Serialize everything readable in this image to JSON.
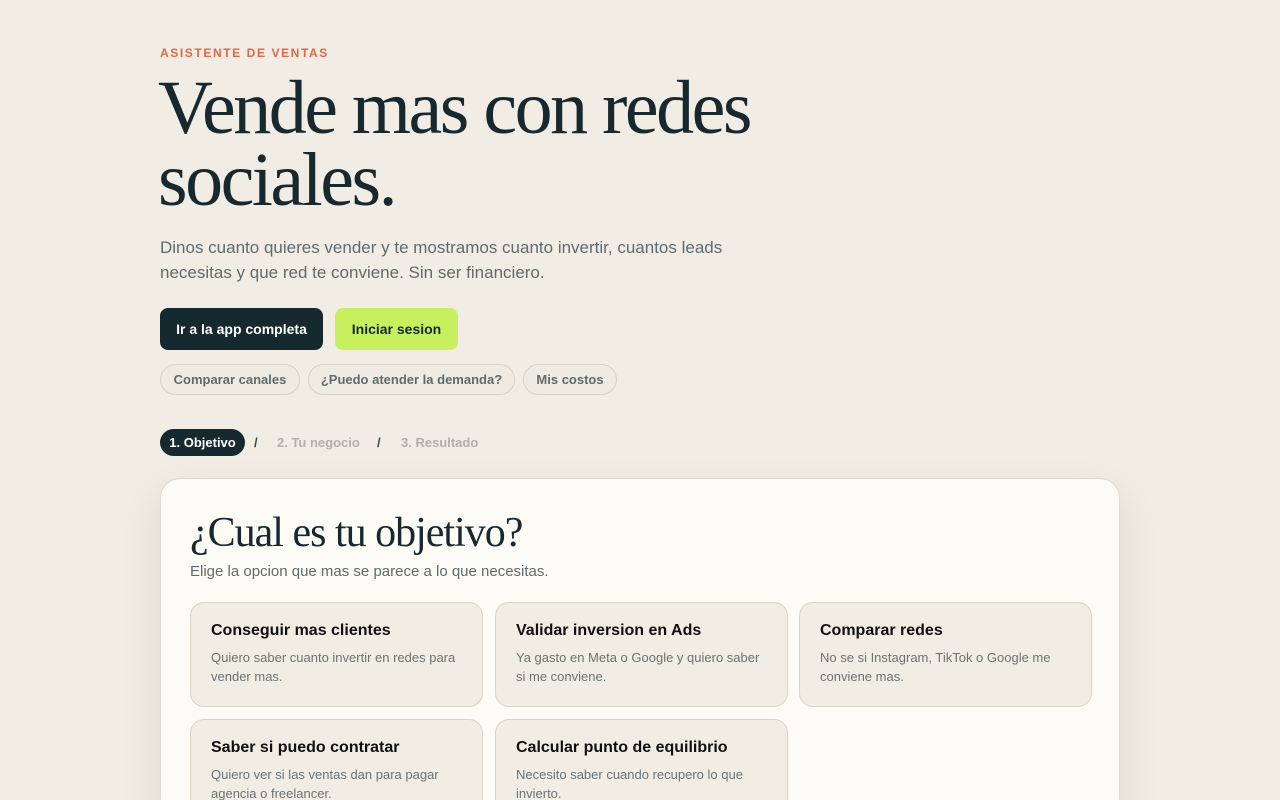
{
  "hero": {
    "eyebrow": "ASISTENTE DE VENTAS",
    "title_line1": "Vende mas con redes",
    "title_line2": "sociales.",
    "subtitle": "Dinos cuanto quieres vender y te mostramos cuanto invertir, cuantos leads necesitas y que red te conviene. Sin ser financiero."
  },
  "actions": {
    "primary_label": "Ir a la app completa",
    "secondary_label": "Iniciar sesion"
  },
  "shortcuts": [
    {
      "label": "Comparar canales"
    },
    {
      "label": "¿Puedo atender la demanda?"
    },
    {
      "label": "Mis costos"
    }
  ],
  "steps": {
    "separator": "/",
    "items": [
      {
        "label": "1. Objetivo",
        "active": true
      },
      {
        "label": "2. Tu negocio",
        "active": false
      },
      {
        "label": "3. Resultado",
        "active": false
      }
    ]
  },
  "objective": {
    "title": "¿Cual es tu objetivo?",
    "subtitle": "Elige la opcion que mas se parece a lo que necesitas.",
    "options": [
      {
        "title": "Conseguir mas clientes",
        "description": "Quiero saber cuanto invertir en redes para vender mas."
      },
      {
        "title": "Validar inversion en Ads",
        "description": "Ya gasto en Meta o Google y quiero saber si me conviene."
      },
      {
        "title": "Comparar redes",
        "description": "No se si Instagram, TikTok o Google me conviene mas."
      },
      {
        "title": "Saber si puedo contratar",
        "description": "Quiero ver si las ventas dan para pagar agencia o freelancer."
      },
      {
        "title": "Calcular punto de equilibrio",
        "description": "Necesito saber cuando recupero lo que invierto."
      }
    ]
  },
  "colors": {
    "background": "#f1ece4",
    "ink": "#16292f",
    "accent_orange": "#e0674a",
    "accent_lime": "#c8ef5e",
    "card": "#fcfbf6"
  }
}
